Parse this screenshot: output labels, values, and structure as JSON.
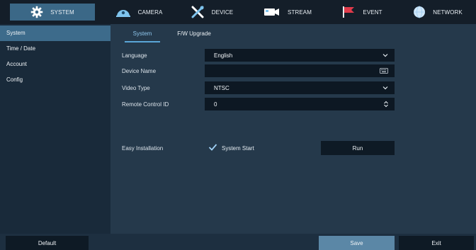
{
  "topnav": {
    "system": {
      "label": "SYSTEM",
      "icon": "gear-icon"
    },
    "camera": {
      "label": "CAMERA",
      "icon": "dome-camera-icon"
    },
    "device": {
      "label": "DEVICE",
      "icon": "tools-icon"
    },
    "stream": {
      "label": "STREAM",
      "icon": "video-camera-icon"
    },
    "event": {
      "label": "EVENT",
      "icon": "flag-icon"
    },
    "network": {
      "label": "NETWORK",
      "icon": "globe-icon"
    }
  },
  "sidebar": {
    "items": [
      {
        "label": "System",
        "active": true
      },
      {
        "label": "Time / Date",
        "active": false
      },
      {
        "label": "Account",
        "active": false
      },
      {
        "label": "Config",
        "active": false
      }
    ]
  },
  "tabs": {
    "system": "System",
    "fw_upgrade": "F/W Upgrade"
  },
  "form": {
    "language": {
      "label": "Language",
      "value": "English"
    },
    "device_name": {
      "label": "Device Name",
      "value": ""
    },
    "video_type": {
      "label": "Video Type",
      "value": "NTSC"
    },
    "remote_control_id": {
      "label": "Remote Control ID",
      "value": "0"
    },
    "easy_installation": {
      "label": "Easy Installation",
      "checkbox_label": "System Start",
      "checked": true,
      "run_label": "Run"
    }
  },
  "bottombar": {
    "default_label": "Default",
    "save_label": "Save",
    "exit_label": "Exit"
  },
  "colors": {
    "accent_active": "#3d6b8b",
    "tab_active_text": "#8ec6ec",
    "field_bg": "#0d1823",
    "save_button": "#5b87a6",
    "event_flag": "#e03a4a"
  }
}
